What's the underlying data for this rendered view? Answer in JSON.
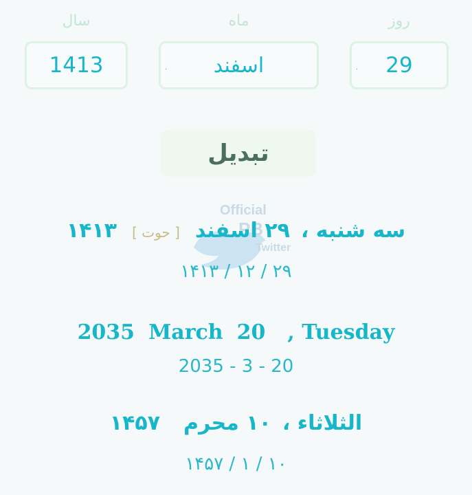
{
  "inputs": {
    "year": {
      "label": "سال",
      "value": "1413"
    },
    "month": {
      "label": "ماه",
      "value": "اسفند",
      "spinner_glyph": "·"
    },
    "day": {
      "label": "روز",
      "value": "29",
      "spinner_glyph": "·"
    }
  },
  "convert_button": {
    "label": "تبدیل"
  },
  "watermark": {
    "line1": "Official",
    "line2": "PB",
    "line3": "Twitter"
  },
  "results": {
    "shamsi": {
      "weekday": "سه شنبه ،",
      "day_month": "۲۹ اسفند",
      "season": "[ حوت ]",
      "year": "۱۴۱۳",
      "numeric": "۲۹ / ۱۲ / ۱۴۱۳"
    },
    "gregorian": {
      "weekday": ", Tuesday",
      "day": "20",
      "month": "March",
      "year": "2035",
      "numeric": "2035 - 3 - 20"
    },
    "hijri": {
      "weekday": "الثلاثاء ،",
      "day_month": "۱۰ محرم",
      "year": "۱۴۵۷",
      "numeric": "۱۰ / ۱ / ۱۴۵۷"
    }
  }
}
